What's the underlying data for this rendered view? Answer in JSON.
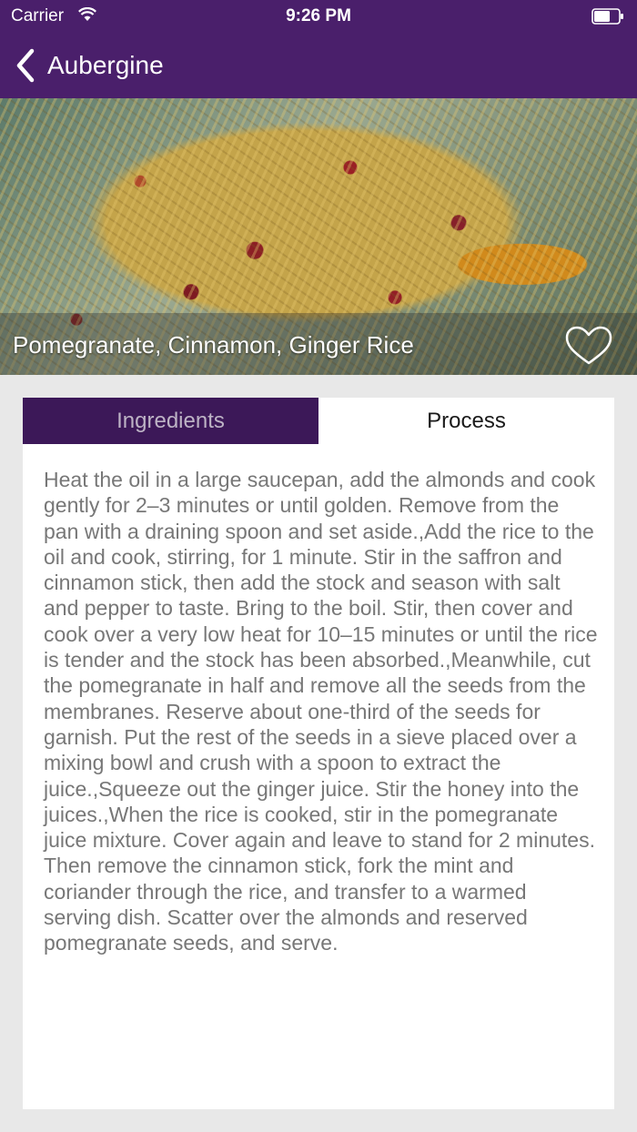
{
  "status_bar": {
    "carrier": "Carrier",
    "time": "9:26 PM"
  },
  "nav": {
    "back_label": "Aubergine"
  },
  "hero": {
    "title": "Pomegranate, Cinnamon, Ginger Rice",
    "favorite_icon": "heart-outline-icon"
  },
  "tabs": [
    {
      "label": "Ingredients",
      "selected": false
    },
    {
      "label": "Process",
      "selected": true
    }
  ],
  "process": {
    "text": "Heat the oil in a large saucepan, add the almonds and cook gently for 2–3 minutes or until golden. Remove from the pan with a draining spoon and set aside.,Add the rice to the oil and cook, stirring, for 1 minute. Stir in the saffron and cinnamon stick, then add the stock and season with salt and pepper to taste. Bring to the boil. Stir, then cover and cook over a very low heat for 10–15 minutes or until the rice is tender and the stock has been absorbed.,Meanwhile, cut the pomegranate in half and remove all the seeds from the membranes. Reserve about one-third of the seeds for garnish. Put the rest of the seeds in a sieve placed over a mixing bowl and crush with a spoon to extract the juice.,Squeeze out the ginger juice. Stir the honey into the juices.,When the rice is cooked, stir in the pomegranate juice mixture. Cover again and leave to stand for 2 minutes. Then remove the cinnamon stick, fork the mint and coriander through the rice, and transfer to a warmed serving dish. Scatter over the almonds and reserved pomegranate seeds, and serve."
  },
  "colors": {
    "header_bg": "#4a1f6b",
    "tab_selected_bg": "#3c1858",
    "page_bg": "#e8e8e8"
  }
}
